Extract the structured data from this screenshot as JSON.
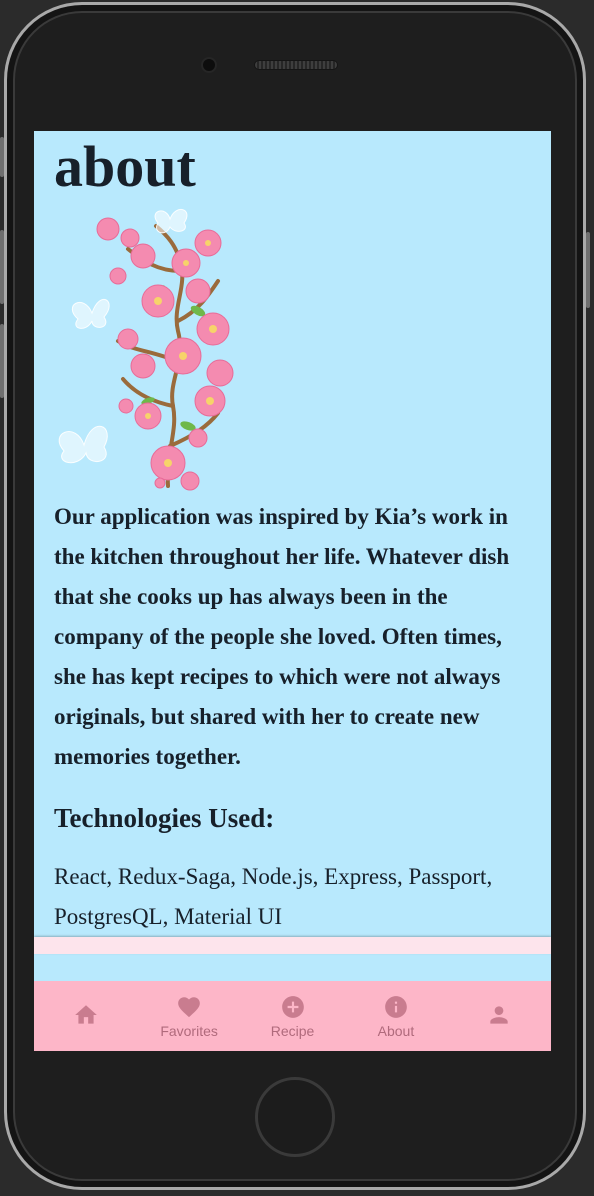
{
  "page": {
    "title": "about",
    "paragraph": "Our application was inspired by Kia’s work in the kitchen throughout her life. Whatever dish that she cooks up has always been in the company of the people she loved. Often times, she has kept recipes to which were not always originals, but shared with her to create new memories together.",
    "tech_heading": "Technologies Used:",
    "tech_list": "React, Redux-Saga, Node.js, Express, Passport, PostgresQL, Material UI"
  },
  "bottom_nav": {
    "items": [
      {
        "icon": "home-icon",
        "label": ""
      },
      {
        "icon": "heart-icon",
        "label": "Favorites"
      },
      {
        "icon": "add-circle-icon",
        "label": "Recipe"
      },
      {
        "icon": "info-icon",
        "label": "About"
      },
      {
        "icon": "person-icon",
        "label": ""
      }
    ]
  },
  "colors": {
    "screen_bg": "#b8e9fd",
    "nav_bg": "#fdb6c8",
    "nav_icon": "#c97c8f",
    "text": "#17202a"
  }
}
